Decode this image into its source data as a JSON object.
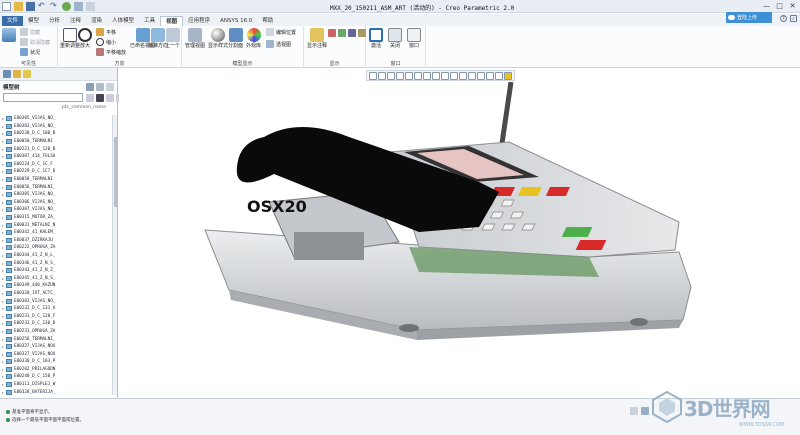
{
  "window": {
    "title": "MXX_20_150211_ASM_ART (活动的) - Creo Parametric 2.0",
    "minimize": "—",
    "maximize": "□",
    "close": "✕"
  },
  "tabs": [
    "文件",
    "模型",
    "分析",
    "注释",
    "渲染",
    "人体模型",
    "工具",
    "视图",
    "应用程序",
    "ANSYS 16.0",
    "帮助"
  ],
  "active_tab_index": 7,
  "login_label": "登陆上传",
  "ribbon": {
    "groups": {
      "visibility": "可见性",
      "orientation": "方向",
      "model_display": "模型显示",
      "display": "显示",
      "window": "窗口"
    },
    "visibility": {
      "hide": "隐藏",
      "unhide": "取消隐藏",
      "status": "状况"
    },
    "orientation": {
      "refit": "重新调整",
      "zoom_in": "放大",
      "pan": "平移",
      "zoom_out": "缩小",
      "pan_zoom": "平移缩放",
      "saved": "已命名视图",
      "standard": "标准方向",
      "previous": "上一个"
    },
    "model_display": {
      "manager": "管理视图",
      "display_style": "显示样式",
      "section": "分割面",
      "appearance": "外观库",
      "edit_pos": "编辑位置",
      "perspective": "透视图"
    },
    "display_group": {
      "show_annot": "显示注释"
    },
    "window_group": {
      "activate": "激活",
      "close": "关闭",
      "windows": "窗口"
    }
  },
  "left_panel": {
    "title": "模型树",
    "column_name": "ptc_common_name",
    "insert_label": "在此插入",
    "items": [
      "E00305_VIJAS_NO_",
      "E00303_VIJAS_NO_",
      "E00230_D_C_100_B",
      "E00050_TERMALNI",
      "E00221_D_C_120_B",
      "E00307_414_FOLSO",
      "E00224_D_C_1C_F",
      "E00229_D_C_1C7_D",
      "E00058_TERMALNI",
      "E00056_TERMALNI_",
      "E00305_VIJAS_NO_",
      "E00306_VIJAS_NO_",
      "E00307_VIJAS_NO_",
      "E00315_MOTOR_ZA_",
      "E00031_METALNI_N",
      "E00342_41_KALEM_",
      "E00037_DZIRKAJU",
      "E00222_OPRUGA_ZA",
      "E00344_41_Z_N_L_",
      "E00346_41_Z_N_S_",
      "E00343_41_Z_N_Z_",
      "E00345_41_Z_N_S_",
      "E00349_440_KAZUN",
      "E00320_IVT_ACTC_",
      "E00303_VIJAS_NO_",
      "E00232_D_C_131_A",
      "E00231_D_C_120_F",
      "E00232_D_C_130_D",
      "E00231_OPRUGA_ZA",
      "E00256_TERMALNI_",
      "E00327_VIJAS_NOX",
      "E00327_VIJAS_NOX",
      "E00330_D_C_103_P",
      "E00202_PRILAGODN",
      "E00240_D_C_150_P",
      "E00111_DISPLEJ_W",
      "E00328_BATERIJA_",
      "E00352_GUMENE_NO",
      "E00327_100_FOGLO"
    ]
  },
  "status": {
    "msg1": "基准平面将不显示。",
    "msg2": "选择一个最低平面平面平面或位置。"
  },
  "watermark": {
    "text": "3D世界网",
    "sub": "WWW.3DSJW.COM"
  },
  "model_label": "OSX20",
  "colors": {
    "accent": "#3a6ea8",
    "login": "#3d8fd6",
    "body_grey": "#d8dadc",
    "cover_black": "#0a0a0a",
    "key_red": "#d92a2a",
    "key_yellow": "#e8c21e",
    "key_green": "#4db04a"
  }
}
